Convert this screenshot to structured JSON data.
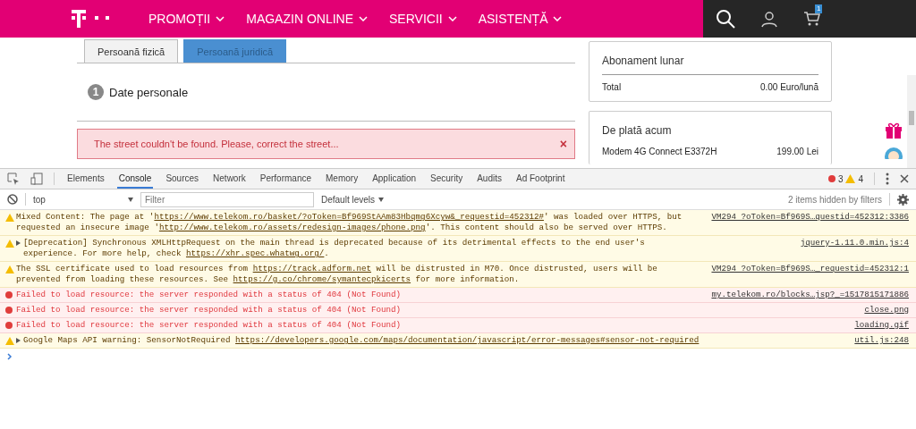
{
  "header": {
    "nav": [
      {
        "label": "PROMOȚII"
      },
      {
        "label": "MAGAZIN ONLINE"
      },
      {
        "label": "SERVICII"
      },
      {
        "label": "ASISTENȚĂ"
      }
    ],
    "cart_count": "1"
  },
  "tabs": [
    {
      "label": "Persoană fizică",
      "selected": false
    },
    {
      "label": "Persoană juridică",
      "selected": true
    }
  ],
  "step": {
    "number": "1",
    "title": "Date personale"
  },
  "alert": {
    "message": "The street couldn't be found. Please, correct the street...",
    "close": "×"
  },
  "subscription": {
    "title": "Abonament lunar",
    "total_label": "Total",
    "total_value": "0.00 Euro/lună"
  },
  "pay_now": {
    "title": "De plată acum",
    "items": [
      {
        "name": "Modem 4G Connect E3372H",
        "price": "199.00 Lei"
      }
    ]
  },
  "devtools": {
    "tabs": [
      {
        "label": "Elements",
        "selected": false
      },
      {
        "label": "Console",
        "selected": true
      },
      {
        "label": "Sources",
        "selected": false
      },
      {
        "label": "Network",
        "selected": false
      },
      {
        "label": "Performance",
        "selected": false
      },
      {
        "label": "Memory",
        "selected": false
      },
      {
        "label": "Application",
        "selected": false
      },
      {
        "label": "Security",
        "selected": false
      },
      {
        "label": "Audits",
        "selected": false
      },
      {
        "label": "Ad Footprint",
        "selected": false
      }
    ],
    "error_count": "3",
    "warning_count": "4",
    "context": "top",
    "filter_placeholder": "Filter",
    "levels": "Default levels",
    "hidden": "2 items hidden by filters",
    "messages": [
      {
        "kind": "warning",
        "expandable": false,
        "parts": [
          {
            "text": "Mixed Content: The page at '",
            "link": false
          },
          {
            "text": "https://www.telekom.ro/basket/?oToken=Bf969StAAm83Hbqmg6Xcyw&_requestid=452312#",
            "link": true
          },
          {
            "text": "' was loaded over HTTPS, but requested an insecure image '",
            "link": false
          },
          {
            "text": "http://www.telekom.ro/assets/redesign-images/phone.png",
            "link": true
          },
          {
            "text": "'. This content should also be served over HTTPS.",
            "link": false
          }
        ],
        "source": "VM294 ?oToken=Bf969S…questid=452312:3386"
      },
      {
        "kind": "warning",
        "expandable": true,
        "parts": [
          {
            "text": "[Deprecation] Synchronous XMLHttpRequest on the main thread is deprecated because of its detrimental effects to the end user's experience. For more help, check ",
            "link": false
          },
          {
            "text": "https://xhr.spec.whatwg.org/",
            "link": true
          },
          {
            "text": ".",
            "link": false
          }
        ],
        "source": "jquery-1.11.0.min.js:4"
      },
      {
        "kind": "warning",
        "expandable": false,
        "parts": [
          {
            "text": "The SSL certificate used to load resources from ",
            "link": false
          },
          {
            "text": "https://track.adform.net",
            "link": true
          },
          {
            "text": " will be distrusted in M70. Once distrusted, users will be prevented from loading these resources. See ",
            "link": false
          },
          {
            "text": "https://g.co/chrome/symantecpkicerts",
            "link": true
          },
          {
            "text": " for more information.",
            "link": false
          }
        ],
        "source": "VM294 ?oToken=Bf969S…_requestid=452312:1"
      },
      {
        "kind": "error",
        "expandable": false,
        "parts": [
          {
            "text": "Failed to load resource: the server responded with a status of 404 (Not Found)",
            "link": false
          }
        ],
        "source": "my.telekom.ro/blocks…jsp?_=1517815171886"
      },
      {
        "kind": "error",
        "expandable": false,
        "parts": [
          {
            "text": "Failed to load resource: the server responded with a status of 404 (Not Found)",
            "link": false
          }
        ],
        "source": "close.png"
      },
      {
        "kind": "error",
        "expandable": false,
        "parts": [
          {
            "text": "Failed to load resource: the server responded with a status of 404 (Not Found)",
            "link": false
          }
        ],
        "source": "loading.gif"
      },
      {
        "kind": "warning",
        "expandable": true,
        "parts": [
          {
            "text": "Google Maps API warning: SensorNotRequired ",
            "link": false
          },
          {
            "text": "https://developers.google.com/maps/documentation/javascript/error-messages#sensor-not-required",
            "link": true
          }
        ],
        "source": "util.js:248"
      }
    ]
  }
}
